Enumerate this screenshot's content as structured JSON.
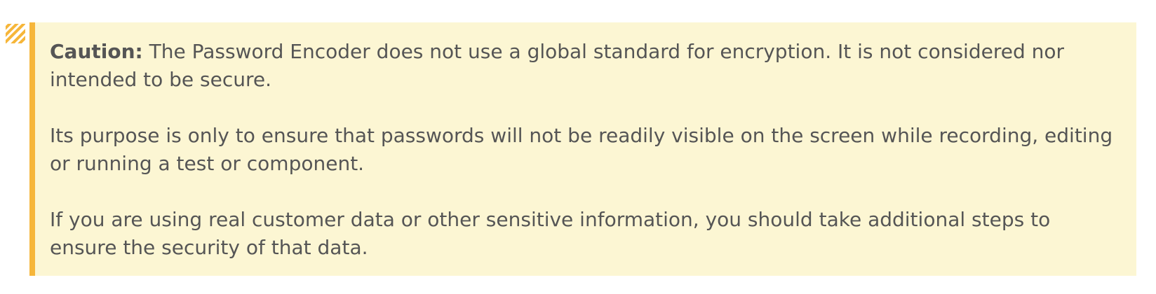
{
  "callout": {
    "label": "Caution:",
    "first_text": " The Password Encoder does not use a global standard for encryption. It is not considered nor intended to be secure.",
    "paragraphs": [
      "Its purpose is only to ensure that passwords will not be readily visible on the screen while recording, editing or running a test or component.",
      "If you are using real customer data or other sensitive information, you should take additional steps to ensure the security of that data."
    ]
  },
  "colors": {
    "background": "#fcf6d3",
    "accent_border": "#f6b63a",
    "text": "#555555"
  },
  "icon": "caution-stripes-icon"
}
